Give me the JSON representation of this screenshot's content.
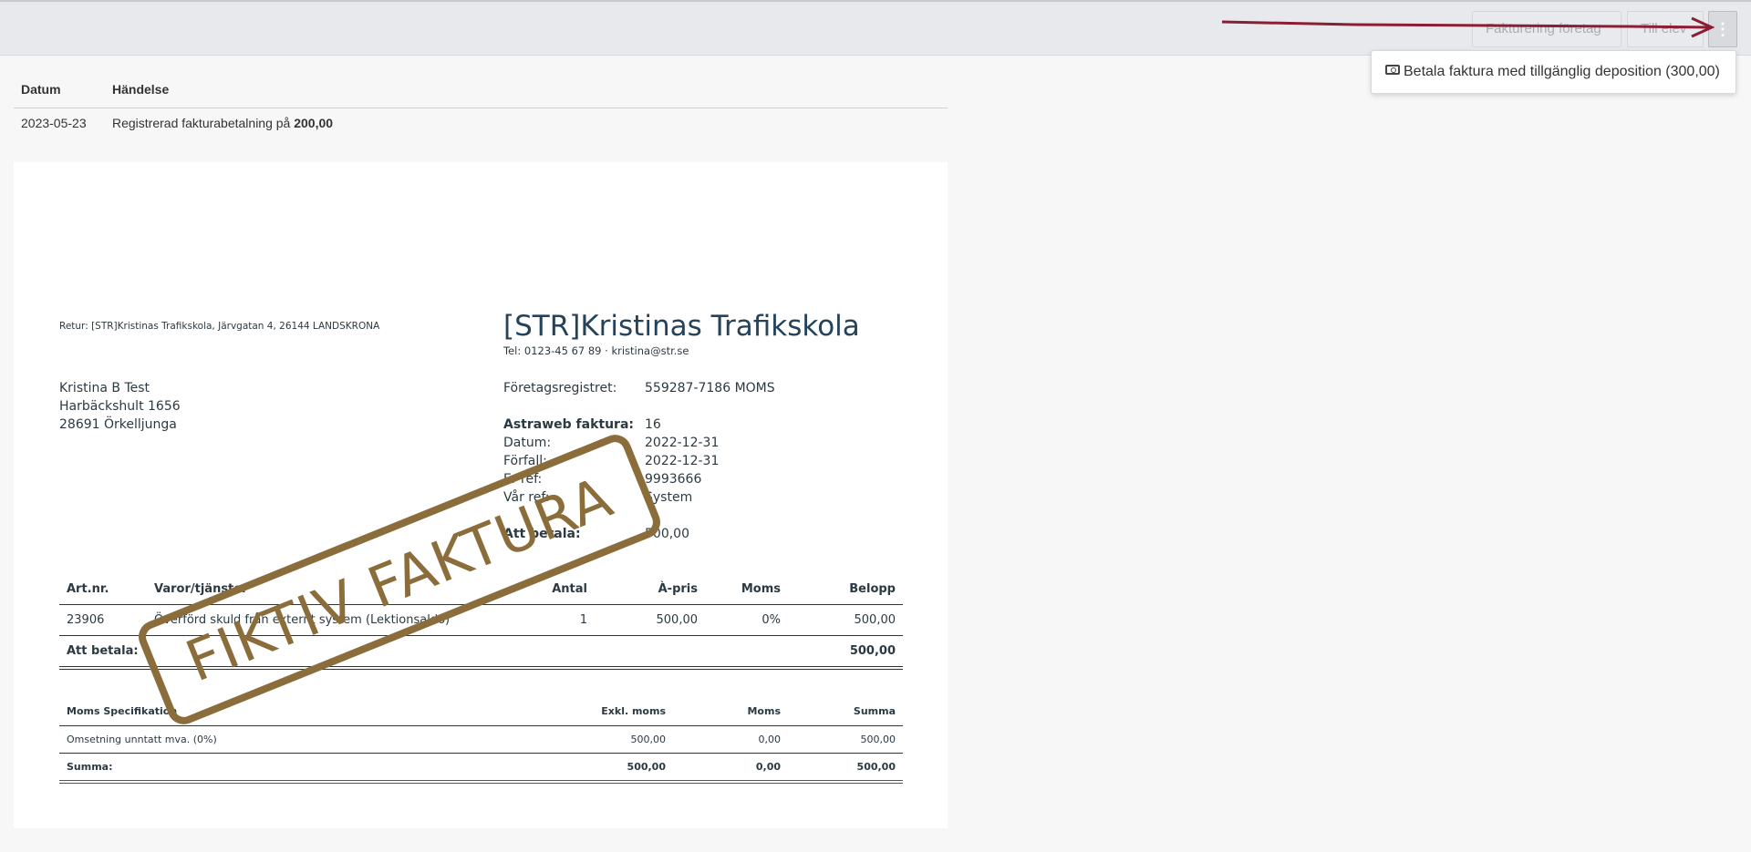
{
  "toolbar": {
    "fakturering_label": "Fakturering företag",
    "elev_label": "Till elev",
    "more_label": "⋮"
  },
  "dropdown": {
    "item_label": "Betala faktura med tillgänglig deposition (300,00)",
    "icon": "money-icon"
  },
  "history": {
    "headers": [
      "Datum",
      "Händelse"
    ],
    "rows": [
      {
        "date": "2023-05-23",
        "event_prefix": "Registrerad fakturabetalning på ",
        "event_amount": "200,00"
      }
    ]
  },
  "invoice": {
    "retur": "Retur: [STR]Kristinas Trafikskola, Järvgatan 4, 26144 LANDSKRONA",
    "company": "[STR]Kristinas Trafikskola",
    "contact": "Tel: 0123-45 67 89 · kristina@str.se",
    "recipient": [
      "Kristina B Test",
      "Harbäckshult 1656",
      "28691 Örkelljunga"
    ],
    "meta": {
      "foretagsregistret_label": "Företagsregistret:",
      "foretagsregistret_value": "559287-7186 MOMS",
      "faktura_label": "Astraweb faktura:",
      "faktura_value": "16",
      "datum_label": "Datum:",
      "datum_value": "2022-12-31",
      "forfall_label": "Förfall:",
      "forfall_value": "2022-12-31",
      "er_ref_label": "Er ref:",
      "er_ref_value": "9993666",
      "var_ref_label": "Vår ref:",
      "var_ref_value": "System",
      "att_betala_label": "Att betala:",
      "att_betala_value": "500,00"
    },
    "items_headers": [
      "Art.nr.",
      "Varor/tjänster",
      "Antal",
      "À-pris",
      "Moms",
      "Belopp"
    ],
    "items": [
      {
        "artnr": "23906",
        "desc": "Överförd skuld från externt system (Lektionsaldo)",
        "antal": "1",
        "apris": "500,00",
        "moms": "0%",
        "belopp": "500,00"
      }
    ],
    "items_total_label": "Att betala:",
    "items_total_value": "500,00",
    "moms_headers": [
      "Moms Specifikation",
      "Exkl. moms",
      "Moms",
      "Summa"
    ],
    "moms_rows": [
      {
        "desc": "Omsetning unntatt mva. (0%)",
        "exkl": "500,00",
        "moms": "0,00",
        "summa": "500,00"
      }
    ],
    "moms_total": {
      "label": "Summa:",
      "exkl": "500,00",
      "moms": "0,00",
      "summa": "500,00"
    },
    "stamp": "FIKTIV FAKTURA"
  },
  "colors": {
    "stamp": "#8a6d3b",
    "arrow": "#8b1e34",
    "company": "#24425a"
  }
}
